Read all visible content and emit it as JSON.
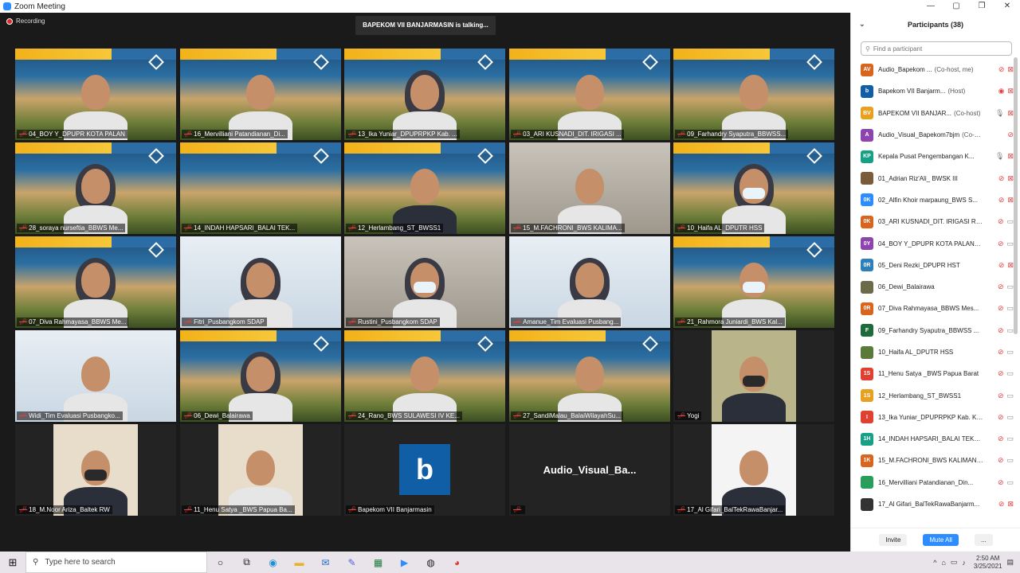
{
  "window": {
    "title": "Zoom Meeting",
    "controls": [
      "—",
      "▢",
      "❐",
      "✕"
    ]
  },
  "meeting": {
    "recording_label": "Recording",
    "talking_banner": "BAPEKOM VII BANJARMASIN is talking..."
  },
  "tiles": [
    {
      "label": "04_BOY Y_DPUPR KOTA PALAN",
      "bg": "banner",
      "person": "man"
    },
    {
      "label": "16_Mervilliani Patandianan_Di...",
      "bg": "banner",
      "person": "woman"
    },
    {
      "label": "13_Ika Yuniar_DPUPRPKP Kab. ...",
      "bg": "banner",
      "person": "hijab"
    },
    {
      "label": "03_ARI KUSNADI_DIT. IRIGASI ...",
      "bg": "banner",
      "person": "man"
    },
    {
      "label": "09_Farhandry Syaputra_BBWSS...",
      "bg": "banner",
      "person": "man"
    },
    {
      "label": "28_soraya nurseftia_BBWS Me...",
      "bg": "banner",
      "person": "hijab"
    },
    {
      "label": "14_INDAH HAPSARI_BALAI TEK...",
      "bg": "banner",
      "person": "none"
    },
    {
      "label": "12_Herlambang_ST_BWSS1",
      "bg": "banner",
      "person": "man-dark"
    },
    {
      "label": "15_M.FACHRONI_BWS KALIMA...",
      "bg": "room",
      "person": "man"
    },
    {
      "label": "10_Haifa AL_DPUTR HSS",
      "bg": "banner",
      "person": "hijab-mask"
    },
    {
      "label": "07_Diva Rahmayasa_BBWS Me...",
      "bg": "banner",
      "person": "hijab"
    },
    {
      "label": "Fitri_Pusbangkom SDAP",
      "bg": "white",
      "person": "hijab"
    },
    {
      "label": "Rustini_Pusbangkom SDAP",
      "bg": "room",
      "person": "hijab-mask"
    },
    {
      "label": "Amanue_Tim Evaluasi Pusbang...",
      "bg": "white",
      "person": "hijab"
    },
    {
      "label": "21_Rahmora Juniardi_BWS Kal...",
      "bg": "banner",
      "person": "man-mask"
    },
    {
      "label": "Widi_Tim Evaluasi Pusbangko...",
      "bg": "white",
      "person": "man"
    },
    {
      "label": "06_Dewi_Balairawa",
      "bg": "banner",
      "person": "hijab"
    },
    {
      "label": "24_Rano_BWS SULAWESI IV KE...",
      "bg": "banner",
      "person": "man"
    },
    {
      "label": "27_SandiMalau_BalaiWilayahSu...",
      "bg": "banner",
      "person": "man"
    },
    {
      "label": "Yogi",
      "bg": "dark",
      "person": "inset-mask"
    },
    {
      "label": "18_M.Noor Ariza_Baltek RW",
      "bg": "dark",
      "person": "inset-mask"
    },
    {
      "label": "11_Henu Satya _BWS Papua Ba...",
      "bg": "dark",
      "person": "inset"
    },
    {
      "label": "Bapekom VII Banjarmasin",
      "bg": "dark",
      "person": "logo",
      "logo_letter": "b"
    },
    {
      "label": "",
      "bg": "dark",
      "person": "text",
      "display_name": "Audio_Visual_Ba..."
    },
    {
      "label": "17_Al Gifari_BalTekRawaBanjar...",
      "bg": "dark",
      "person": "inset-suit"
    }
  ],
  "panel": {
    "title": "Participants (38)",
    "collapse_icon": "chevron-down-icon",
    "search_placeholder": "Find a participant",
    "participants": [
      {
        "initials": "AV",
        "color": "#d9641e",
        "name": "Audio_Bapekom ...",
        "role": "(Co-host, me)",
        "mic": "off",
        "cam": "off"
      },
      {
        "initials": "b",
        "color": "#0f5ea6",
        "name": "Bapekom VII Banjarm...",
        "role": "(Host)",
        "mic": "rec",
        "cam": "off"
      },
      {
        "initials": "BV",
        "color": "#e8a020",
        "name": "BAPEKOM VII BANJAR...",
        "role": "(Co-host)",
        "mic": "on",
        "cam": "off"
      },
      {
        "initials": "A",
        "color": "#8e44ad",
        "name": "Audio_Visual_Bapekom7bjm",
        "role": "(Co-host)",
        "mic": "off",
        "cam": "none"
      },
      {
        "initials": "KP",
        "color": "#16a085",
        "name": "Kepala Pusat Pengembangan K...",
        "role": "",
        "mic": "on",
        "cam": "off"
      },
      {
        "initials": "",
        "color": "#7a5c3c",
        "name": "01_Adrian Riz'Ali_ BWSK III",
        "role": "",
        "mic": "off",
        "cam": "off"
      },
      {
        "initials": "0K",
        "color": "#2d8cff",
        "name": "02_Alfin Khoir marpaung_BWS S...",
        "role": "",
        "mic": "off",
        "cam": "off"
      },
      {
        "initials": "0K",
        "color": "#d9641e",
        "name": "03_ARI KUSNADI_DIT. IRIGASI R...",
        "role": "",
        "mic": "off",
        "cam": "on"
      },
      {
        "initials": "0Y",
        "color": "#8e44ad",
        "name": "04_BOY Y_DPUPR KOTA PALANG...",
        "role": "",
        "mic": "off",
        "cam": "on"
      },
      {
        "initials": "0R",
        "color": "#2c7fb8",
        "name": "05_Deni Rezki_DPUPR HST",
        "role": "",
        "mic": "off",
        "cam": "off"
      },
      {
        "initials": "",
        "color": "#6b6b4a",
        "name": "06_Dewi_Balairawa",
        "role": "",
        "mic": "off",
        "cam": "on"
      },
      {
        "initials": "0R",
        "color": "#d9641e",
        "name": "07_Diva Rahmayasa_BBWS Mes...",
        "role": "",
        "mic": "off",
        "cam": "on"
      },
      {
        "initials": "F",
        "color": "#1e6b3a",
        "name": "09_Farhandry Syaputra_BBWSS ...",
        "role": "",
        "mic": "off",
        "cam": "on"
      },
      {
        "initials": "",
        "color": "#5a7a3c",
        "name": "10_Haifa AL_DPUTR HSS",
        "role": "",
        "mic": "off",
        "cam": "on"
      },
      {
        "initials": "1S",
        "color": "#e04030",
        "name": "11_Henu Satya _BWS Papua Barat",
        "role": "",
        "mic": "off",
        "cam": "on"
      },
      {
        "initials": "1S",
        "color": "#e8a020",
        "name": "12_Herlambang_ST_BWSS1",
        "role": "",
        "mic": "off",
        "cam": "on"
      },
      {
        "initials": "I",
        "color": "#e04030",
        "name": "13_Ika Yuniar_DPUPRPKP Kab. K...",
        "role": "",
        "mic": "off",
        "cam": "on"
      },
      {
        "initials": "1H",
        "color": "#16a085",
        "name": "14_INDAH HAPSARI_BALAI TEKN...",
        "role": "",
        "mic": "off",
        "cam": "on"
      },
      {
        "initials": "1K",
        "color": "#d9641e",
        "name": "15_M.FACHRONI_BWS KALIMAN...",
        "role": "",
        "mic": "off",
        "cam": "on"
      },
      {
        "initials": "",
        "color": "#2a9d5c",
        "name": "16_Mervilliani Patandianan_Din...",
        "role": "",
        "mic": "off",
        "cam": "on"
      },
      {
        "initials": "",
        "color": "#333333",
        "name": "17_Al Gifari_BalTekRawaBanjarm...",
        "role": "",
        "mic": "off",
        "cam": "off"
      }
    ],
    "invite_label": "Invite",
    "mute_all_label": "Mute All",
    "more_label": "..."
  },
  "taskbar": {
    "search_placeholder": "Type here to search",
    "apps": [
      "cortana-icon",
      "task-view-icon",
      "edge-icon",
      "file-explorer-icon",
      "mail-icon",
      "pen-app-icon",
      "excel-icon",
      "zoom-icon",
      "app-icon",
      "chrome-icon"
    ],
    "clock_time": "2:50 AM",
    "clock_date": "3/25/2021"
  }
}
